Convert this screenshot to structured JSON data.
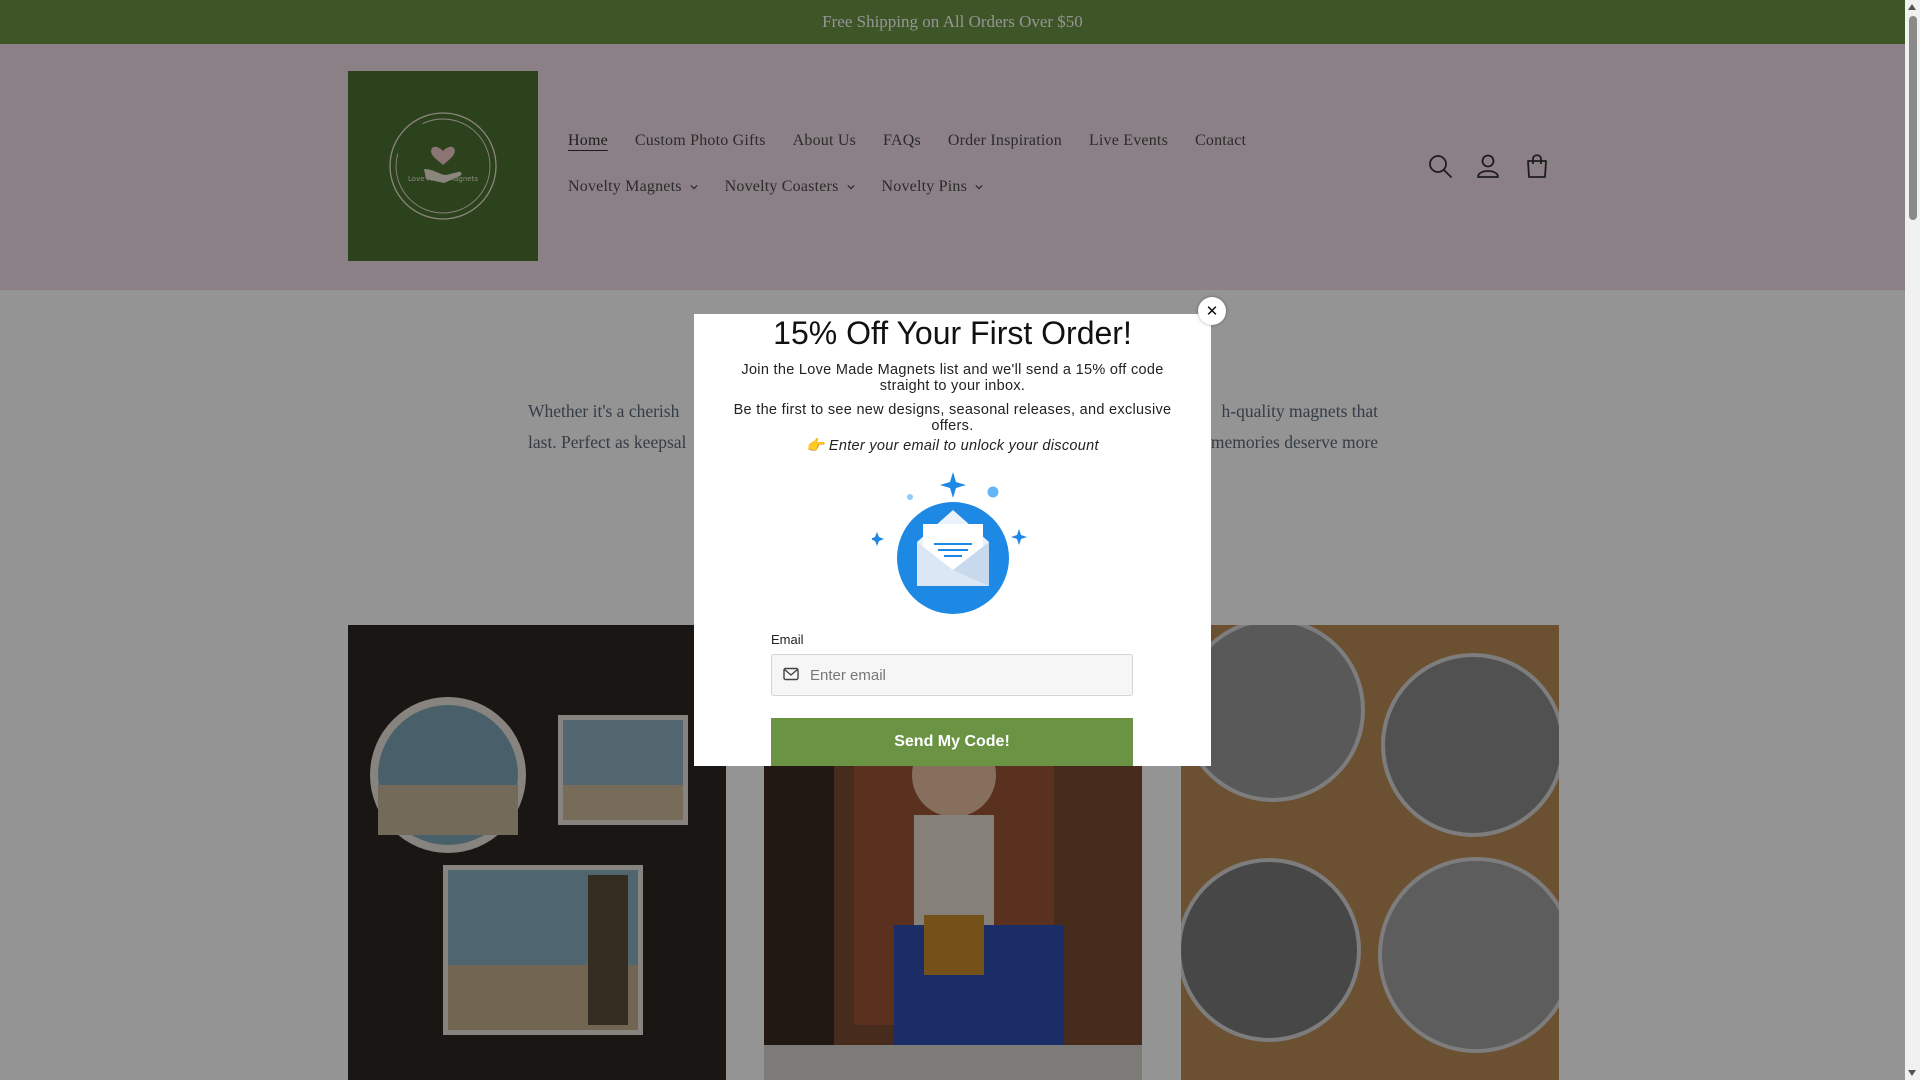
{
  "announcement": {
    "text": "Free Shipping on All Orders Over $50"
  },
  "logo": {
    "text": "Love Made Magnets"
  },
  "nav": {
    "row1": [
      {
        "label": "Home",
        "active": true
      },
      {
        "label": "Custom Photo Gifts"
      },
      {
        "label": "About Us"
      },
      {
        "label": "FAQs"
      },
      {
        "label": "Order Inspiration"
      },
      {
        "label": "Live Events"
      },
      {
        "label": "Contact"
      }
    ],
    "row2": [
      {
        "label": "Novelty Magnets"
      },
      {
        "label": "Novelty Coasters"
      },
      {
        "label": "Novelty Pins"
      }
    ]
  },
  "header_icons": [
    "search-icon",
    "account-icon",
    "cart-icon"
  ],
  "intro": {
    "line1_left": "Whether it's a cherish",
    "line1_right": "h-quality magnets that",
    "line2_left": "last. Perfect as keepsal",
    "line2_right": "memories deserve more"
  },
  "popup": {
    "title": "15% Off Your First Order!",
    "text1": "Join the Love Made Magnets list and we'll send a 15% off code straight to your inbox.",
    "text2": "Be the first to see new designs, seasonal releases, and exclusive offers.",
    "text3": "👉 Enter your email to unlock your discount",
    "email_label": "Email",
    "email_placeholder": "Enter email",
    "email_value": "",
    "submit_label": "Send My Code!",
    "close_label": "✕"
  },
  "colors": {
    "brand_green": "#6a9344",
    "logo_bg": "#4c7332",
    "header_bg": "#f2dde8",
    "envelope_blue": "#1e88e5"
  }
}
